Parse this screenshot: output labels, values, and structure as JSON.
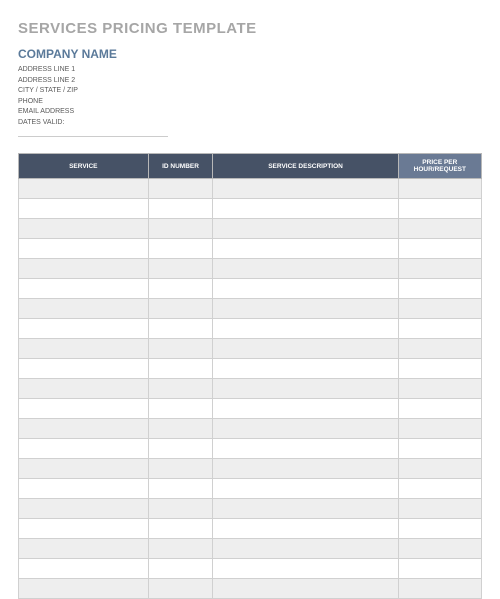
{
  "header": {
    "title": "SERVICES PRICING TEMPLATE",
    "company": "COMPANY NAME",
    "address1": "ADDRESS LINE 1",
    "address2": "ADDRESS LINE 2",
    "citystatezip": "CITY / STATE / ZIP",
    "phone": "PHONE",
    "email": "EMAIL ADDRESS",
    "dates": "DATES VALID:"
  },
  "table": {
    "columns": [
      "SERVICE",
      "ID NUMBER",
      "SERVICE DESCRIPTION",
      "PRICE PER HOUR/REQUEST"
    ],
    "rows": [
      [
        "",
        "",
        "",
        ""
      ],
      [
        "",
        "",
        "",
        ""
      ],
      [
        "",
        "",
        "",
        ""
      ],
      [
        "",
        "",
        "",
        ""
      ],
      [
        "",
        "",
        "",
        ""
      ],
      [
        "",
        "",
        "",
        ""
      ],
      [
        "",
        "",
        "",
        ""
      ],
      [
        "",
        "",
        "",
        ""
      ],
      [
        "",
        "",
        "",
        ""
      ],
      [
        "",
        "",
        "",
        ""
      ],
      [
        "",
        "",
        "",
        ""
      ],
      [
        "",
        "",
        "",
        ""
      ],
      [
        "",
        "",
        "",
        ""
      ],
      [
        "",
        "",
        "",
        ""
      ],
      [
        "",
        "",
        "",
        ""
      ],
      [
        "",
        "",
        "",
        ""
      ],
      [
        "",
        "",
        "",
        ""
      ],
      [
        "",
        "",
        "",
        ""
      ],
      [
        "",
        "",
        "",
        ""
      ],
      [
        "",
        "",
        "",
        ""
      ],
      [
        "",
        "",
        "",
        ""
      ]
    ]
  }
}
